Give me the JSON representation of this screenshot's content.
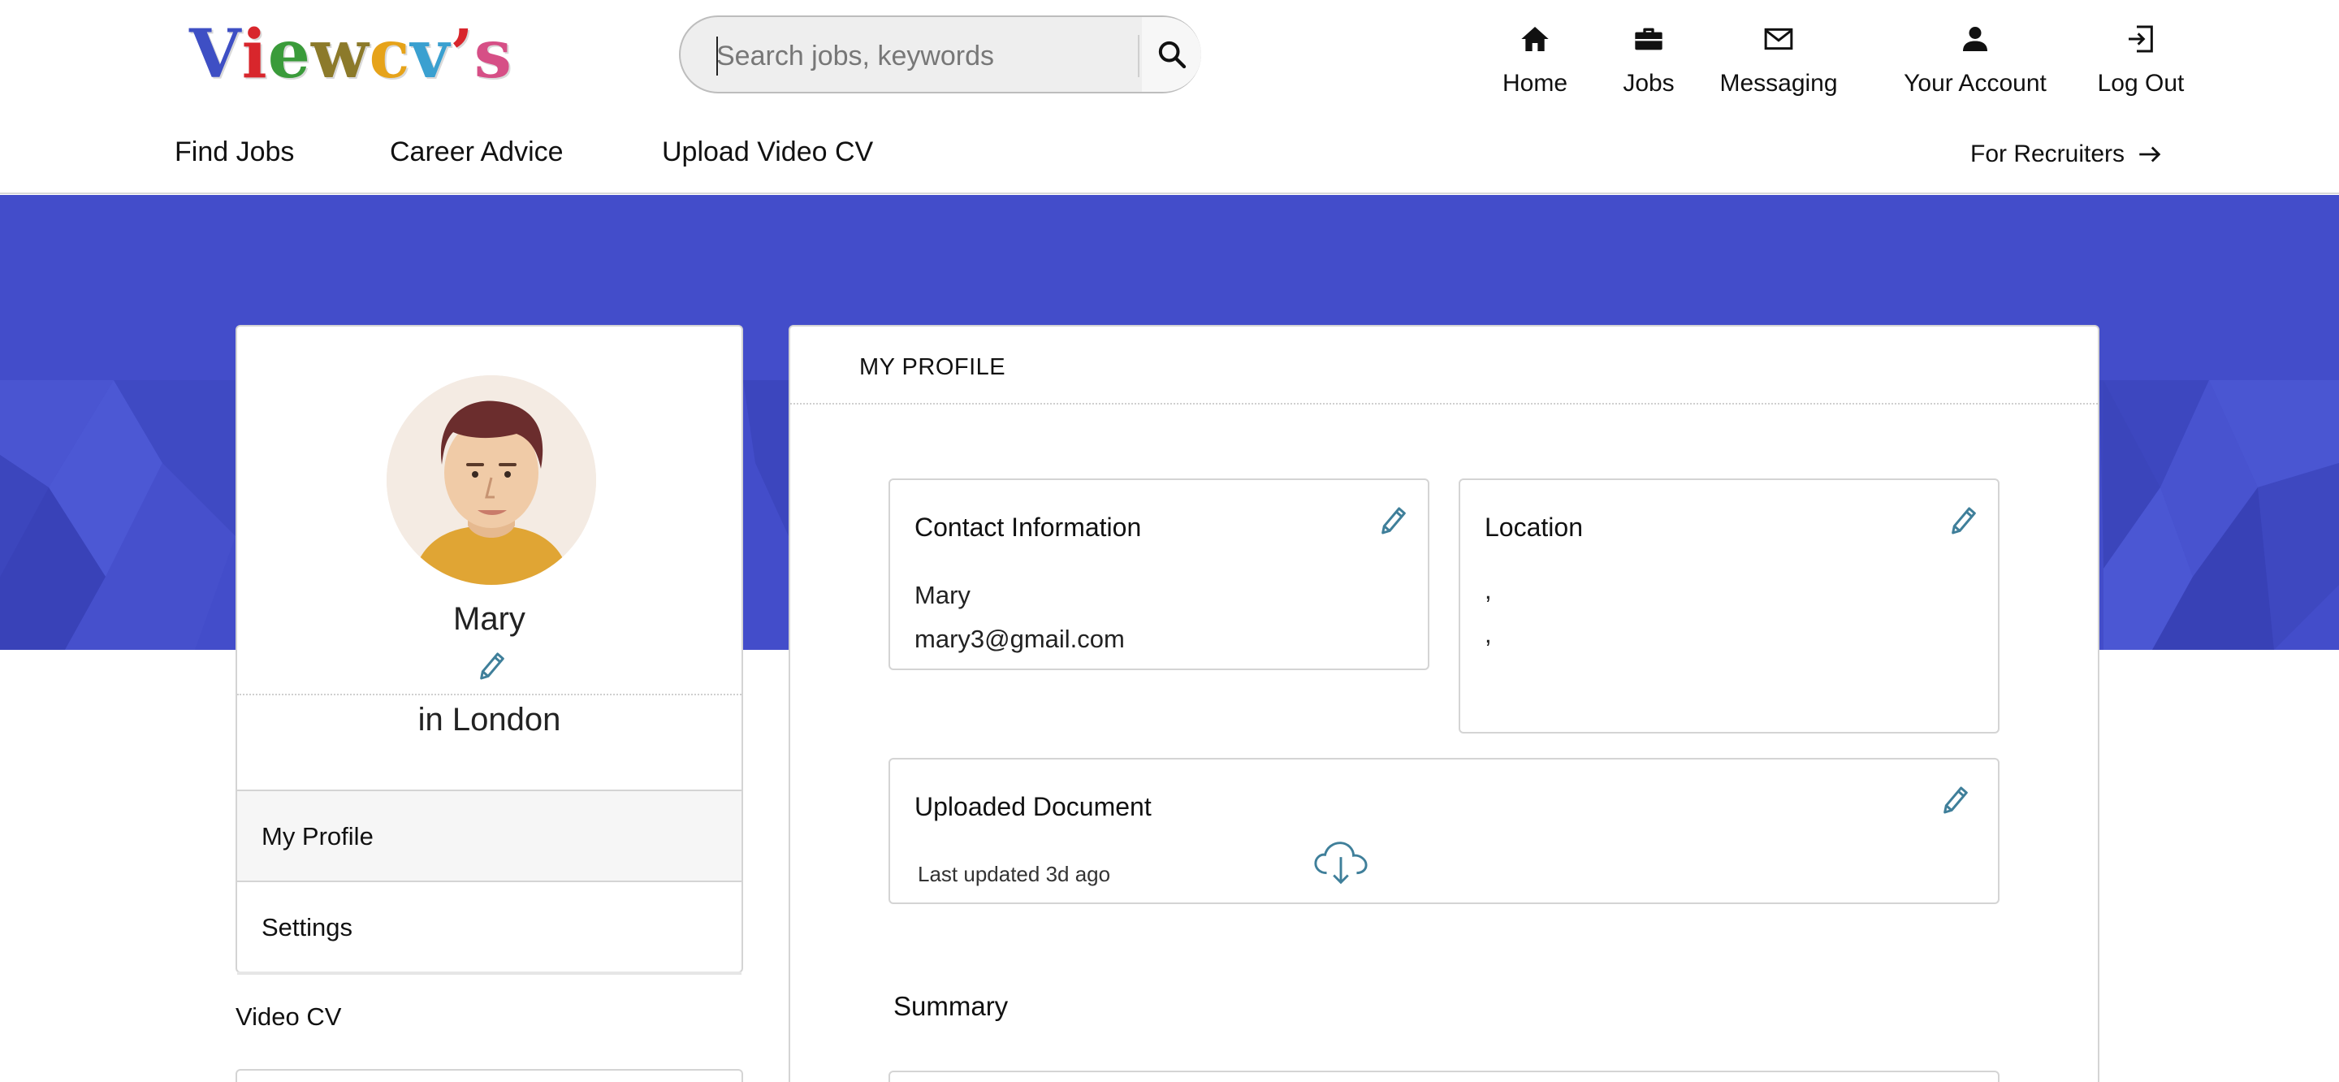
{
  "brand": {
    "logo_letters": [
      {
        "char": "V",
        "color": "#3e4fc4"
      },
      {
        "char": "i",
        "color": "#d8262c"
      },
      {
        "char": "e",
        "color": "#3a9b3a"
      },
      {
        "char": "w",
        "color": "#8c7a2a"
      },
      {
        "char": "c",
        "color": "#e6a31a"
      },
      {
        "char": "v",
        "color": "#3aa0d0"
      },
      {
        "char": "’",
        "color": "#d8262c"
      },
      {
        "char": "s",
        "color": "#d64f86"
      }
    ]
  },
  "search": {
    "placeholder": "Search jobs, keywords",
    "value": "",
    "button_icon": "search-icon"
  },
  "top_nav": [
    {
      "label": "Home",
      "icon": "home-icon"
    },
    {
      "label": "Jobs",
      "icon": "briefcase-icon"
    },
    {
      "label": "Messaging",
      "icon": "envelope-icon"
    },
    {
      "label": "Your Account",
      "icon": "user-icon"
    },
    {
      "label": "Log Out",
      "icon": "logout-icon"
    }
  ],
  "sub_nav": [
    {
      "label": "Find Jobs"
    },
    {
      "label": "Career Advice"
    },
    {
      "label": "Upload Video CV"
    }
  ],
  "for_recruiters": {
    "label": "For Recruiters",
    "icon": "arrow-right-icon"
  },
  "colors": {
    "banner": "#434dca",
    "accent_edit_icon": "#3f7f9a"
  },
  "profile": {
    "name": "Mary",
    "location": "in London",
    "menu": [
      {
        "label": "My Profile",
        "active": true
      },
      {
        "label": "Settings",
        "active": false
      }
    ],
    "video_cv_label": "Video CV"
  },
  "main": {
    "title": "MY PROFILE",
    "contact": {
      "title": "Contact Information",
      "name": "Mary",
      "email": "mary3@gmail.com"
    },
    "location": {
      "title": "Location",
      "line1": ",",
      "line2": ","
    },
    "document": {
      "title": "Uploaded Document",
      "updated": "Last updated 3d ago"
    },
    "summary_label": "Summary"
  }
}
